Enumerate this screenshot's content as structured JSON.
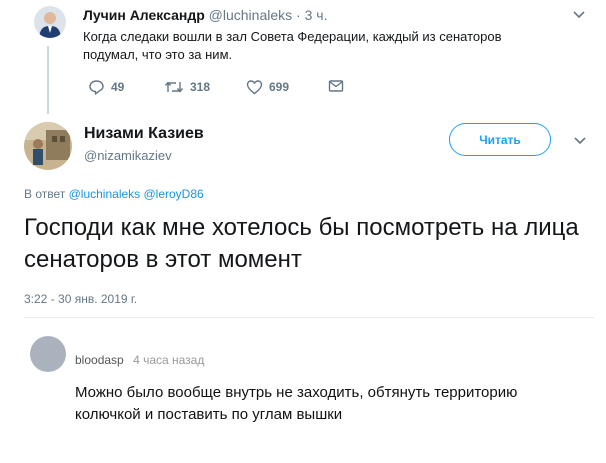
{
  "quoted_tweet": {
    "author_name": "Лучин Александр",
    "handle": "@luchinaleks",
    "separator": "·",
    "time": "3 ч.",
    "text": "Когда следаки вошли в зал Совета Федерации, каждый из сенаторов подумал, что это за ним.",
    "reply_count": "49",
    "retweet_count": "318",
    "like_count": "699"
  },
  "main_tweet": {
    "author_name": "Низами Казиев",
    "handle": "@nizamikaziev",
    "follow_label": "Читать",
    "reply_to_prefix": "В ответ",
    "reply_to_handles": "@luchinaleks @leroyD86",
    "text": "Господи как мне хотелось бы посмотреть на лица сенаторов в этот момент",
    "timestamp": "3:22 - 30 янв. 2019 г."
  },
  "comment": {
    "username": "bloodasp",
    "time": "4 часа назад",
    "text": "Можно было вообще внутрь не заходить, обтянуть территорию колючкой и поставить по углам вышки"
  },
  "colors": {
    "accent": "#1da1f2",
    "link": "#1b95e0",
    "muted": "#657786"
  }
}
